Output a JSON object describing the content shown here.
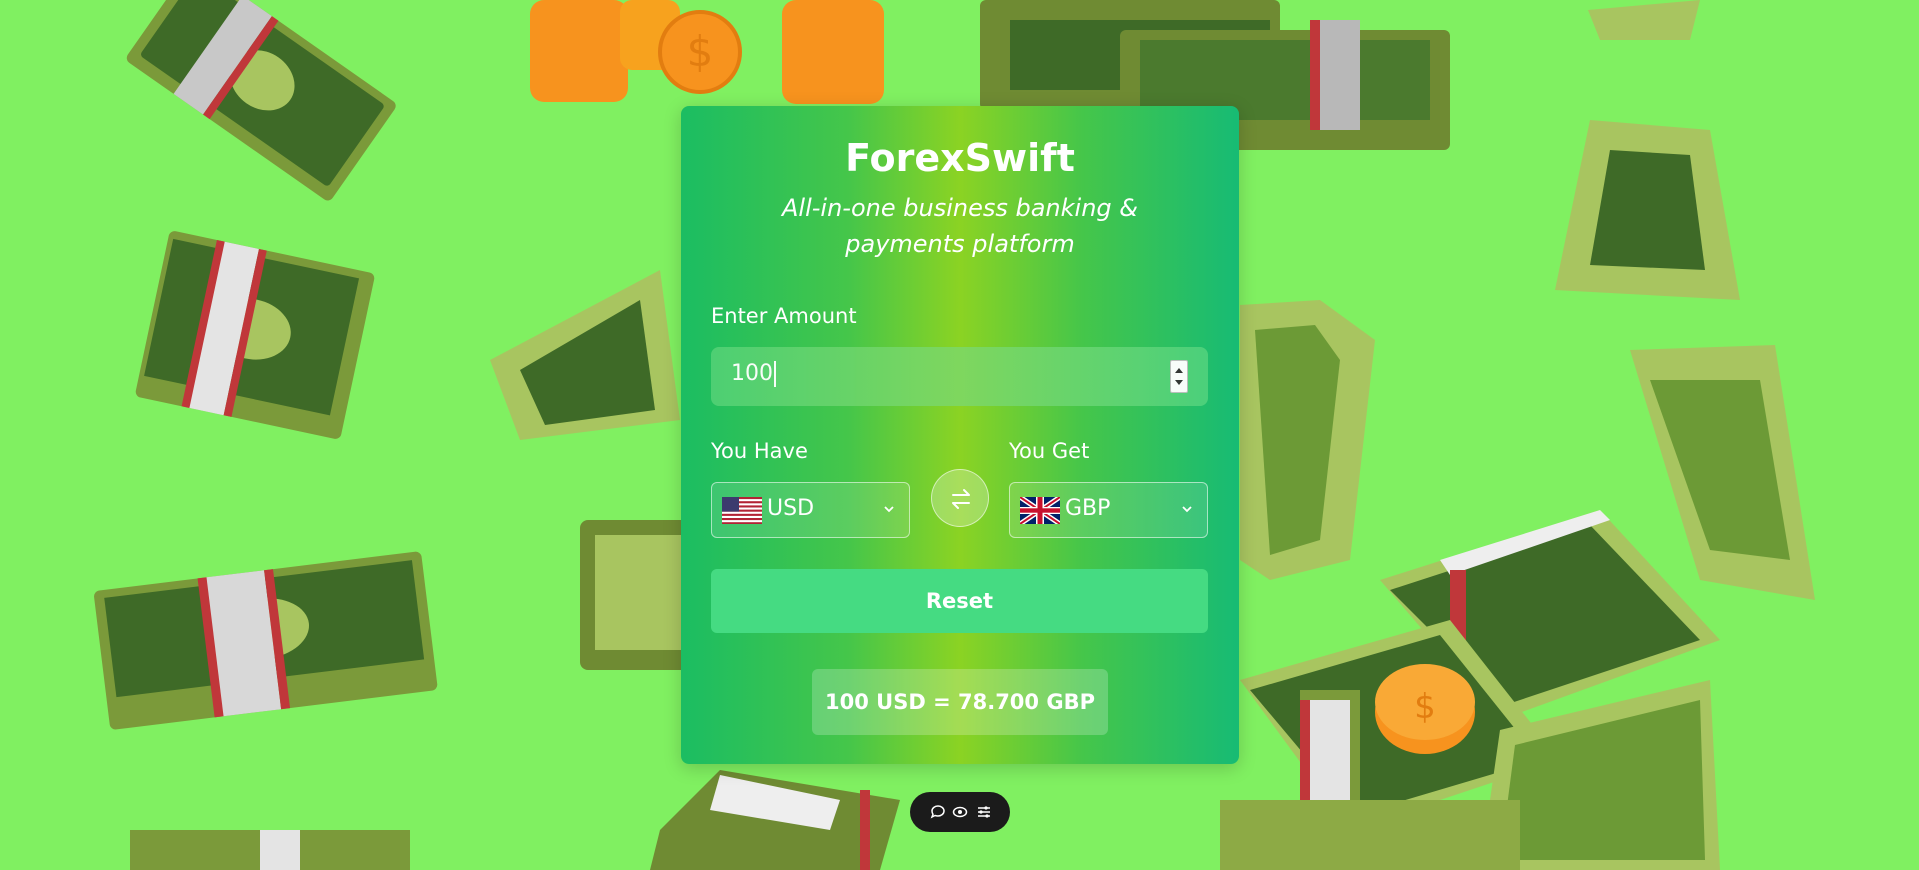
{
  "app": {
    "title": "ForexSwift",
    "subtitle": "All-in-one business banking & payments platform"
  },
  "amount": {
    "label": "Enter Amount",
    "value": "100"
  },
  "from": {
    "label": "You Have",
    "currency": "USD",
    "flag": "us-flag-icon"
  },
  "to": {
    "label": "You Get",
    "currency": "GBP",
    "flag": "uk-flag-icon"
  },
  "swap_icon": "swap-arrows-icon",
  "reset_label": "Reset",
  "result_text": "100 USD = 78.700 GBP",
  "toolbar": {
    "icons": [
      "comment-icon",
      "eye-icon",
      "settings-sliders-icon"
    ]
  },
  "colors": {
    "background": "#80f061",
    "card_left": "#1bbd62",
    "card_mid": "#8bd323",
    "card_right": "#17bb74",
    "reset_button": "#45db82"
  }
}
